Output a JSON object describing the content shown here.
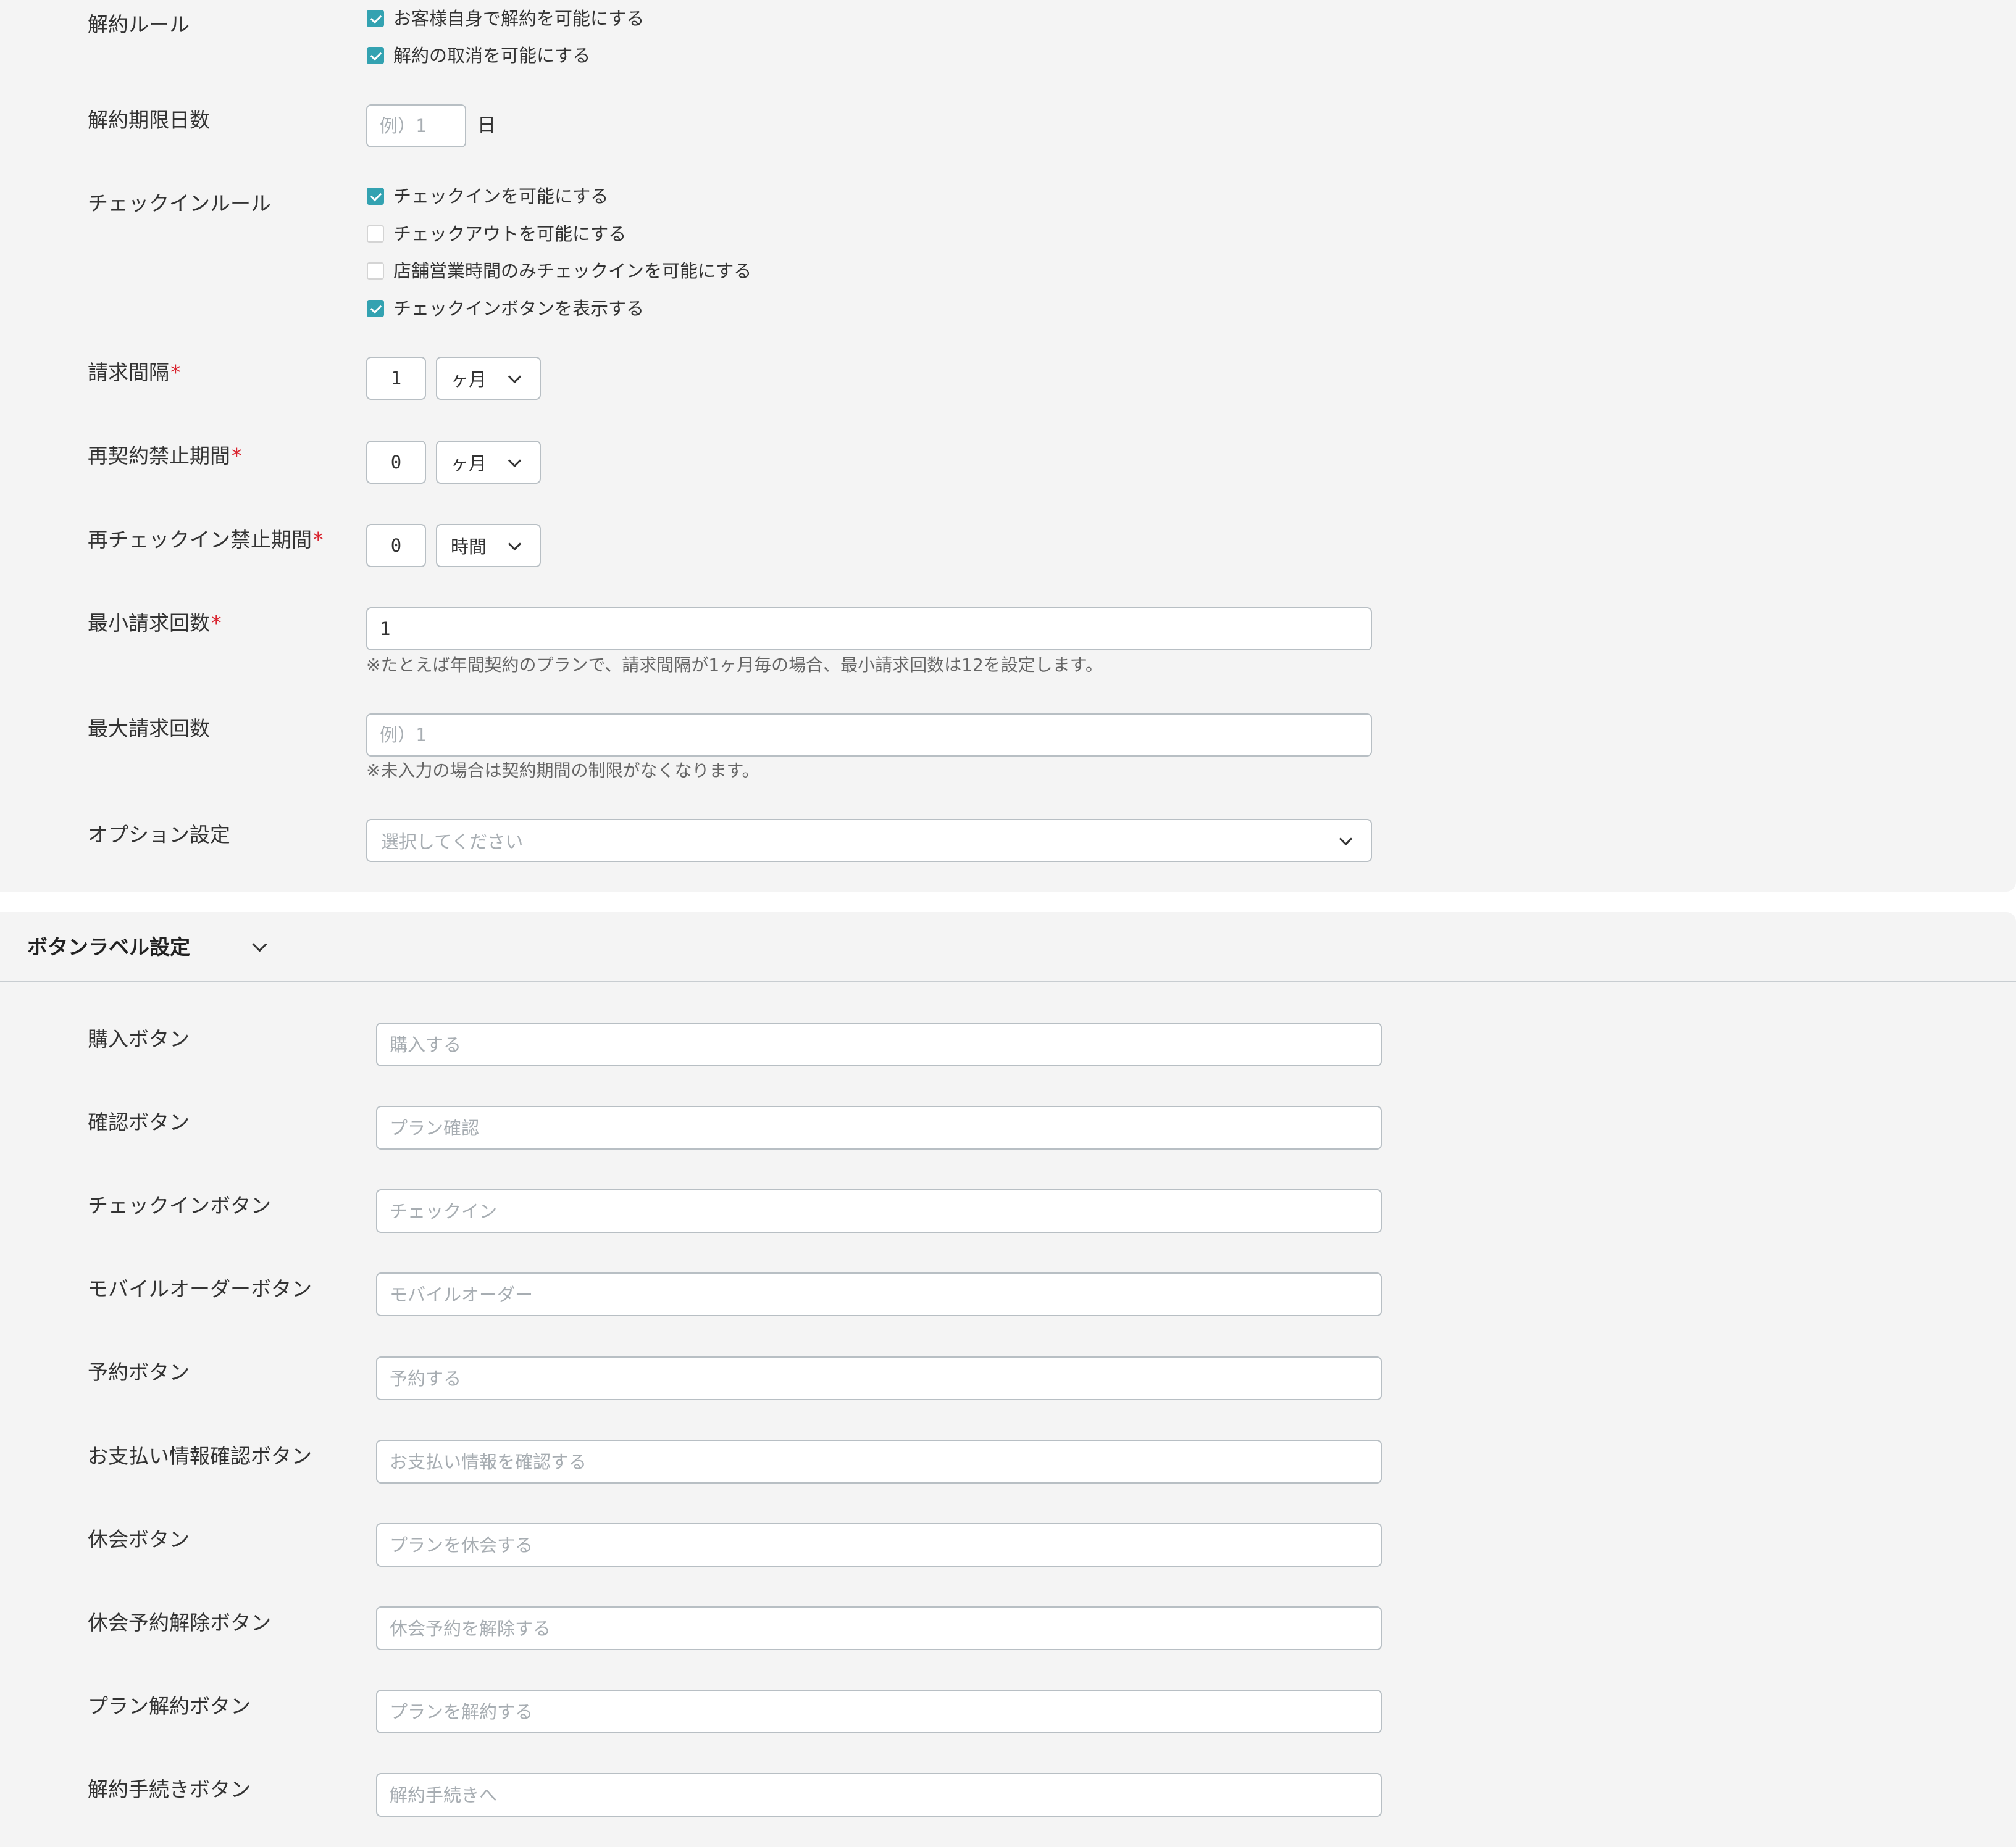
{
  "cancellation": {
    "label": "解約ルール",
    "options": [
      {
        "label": "お客様自身で解約を可能にする",
        "checked": true
      },
      {
        "label": "解約の取消を可能にする",
        "checked": true
      }
    ]
  },
  "cancel_deadline": {
    "label": "解約期限日数",
    "placeholder": "例）1",
    "unit": "日"
  },
  "checkin_rules": {
    "label": "チェックインルール",
    "options": [
      {
        "label": "チェックインを可能にする",
        "checked": true
      },
      {
        "label": "チェックアウトを可能にする",
        "checked": false
      },
      {
        "label": "店舗営業時間のみチェックインを可能にする",
        "checked": false
      },
      {
        "label": "チェックインボタンを表示する",
        "checked": true
      }
    ]
  },
  "billing_interval": {
    "label": "請求間隔",
    "required_mark": "*",
    "value": "1",
    "unit": "ヶ月"
  },
  "recontract_ban": {
    "label": "再契約禁止期間",
    "required_mark": "*",
    "value": "0",
    "unit": "ヶ月"
  },
  "recheckin_ban": {
    "label": "再チェックイン禁止期間",
    "required_mark": "*",
    "value": "0",
    "unit": "時間"
  },
  "min_billing": {
    "label": "最小請求回数",
    "required_mark": "*",
    "value": "1",
    "hint": "※たとえば年間契約のプランで、請求間隔が1ヶ月毎の場合、最小請求回数は12を設定します。"
  },
  "max_billing": {
    "label": "最大請求回数",
    "placeholder": "例）1",
    "hint": "※未入力の場合は契約期間の制限がなくなります。"
  },
  "option_settings": {
    "label": "オプション設定",
    "placeholder": "選択してください"
  },
  "button_labels": {
    "title": "ボタンラベル設定",
    "fields": [
      {
        "label": "購入ボタン",
        "placeholder": "購入する"
      },
      {
        "label": "確認ボタン",
        "placeholder": "プラン確認"
      },
      {
        "label": "チェックインボタン",
        "placeholder": "チェックイン"
      },
      {
        "label": "モバイルオーダーボタン",
        "placeholder": "モバイルオーダー"
      },
      {
        "label": "予約ボタン",
        "placeholder": "予約する"
      },
      {
        "label": "お支払い情報確認ボタン",
        "placeholder": "お支払い情報を確認する"
      },
      {
        "label": "休会ボタン",
        "placeholder": "プランを休会する"
      },
      {
        "label": "休会予約解除ボタン",
        "placeholder": "休会予約を解除する"
      },
      {
        "label": "プラン解約ボタン",
        "placeholder": "プランを解約する"
      },
      {
        "label": "解約手続きボタン",
        "placeholder": "解約手続きへ"
      }
    ]
  },
  "colors": {
    "checkbox_checked": "#33a2b1",
    "required_mark": "#d9232e",
    "panel_background": "#f4f4f4"
  }
}
